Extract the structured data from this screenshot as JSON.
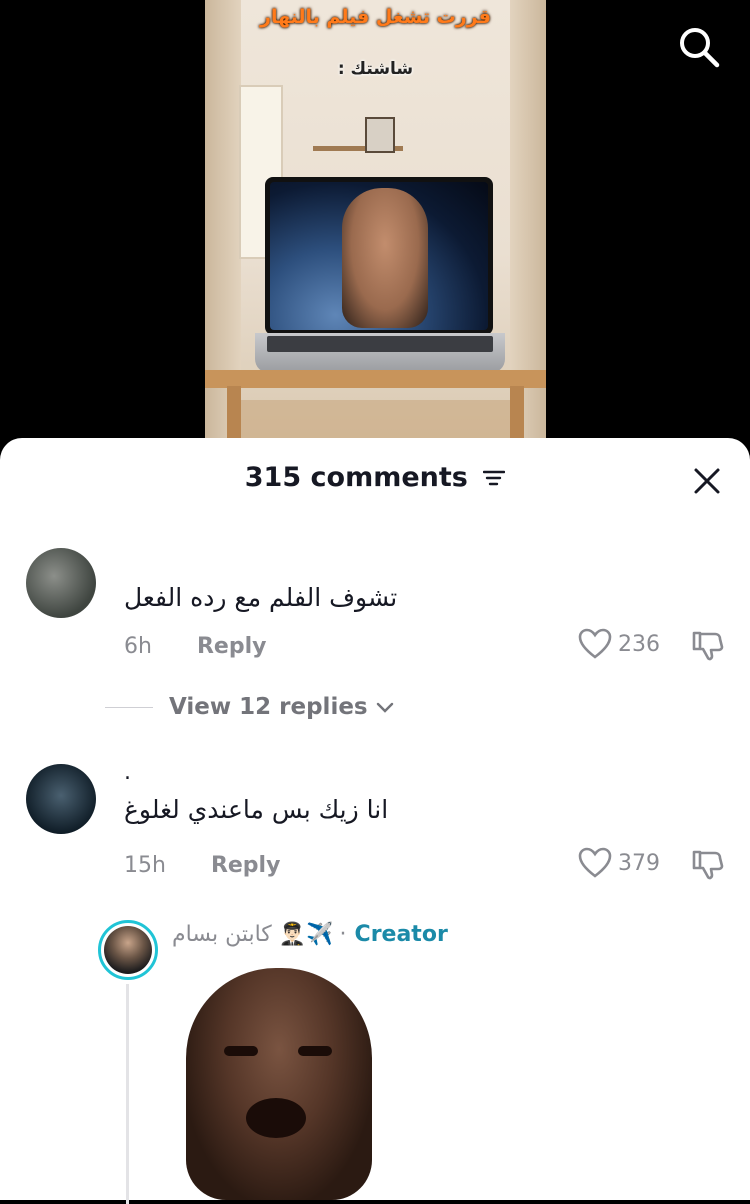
{
  "video": {
    "caption_top": "قررت تشغل فيلم بالنهار",
    "caption_second": "شاشتك :"
  },
  "sheet": {
    "title": "315 comments",
    "close_icon": "close-icon",
    "filter_icon": "filter-icon"
  },
  "comments": [
    {
      "text": "تشوف الفلم مع رده الفعل",
      "time": "6h",
      "reply_label": "Reply",
      "likes": "236",
      "view_replies": "View 12 replies"
    },
    {
      "username": ".",
      "text": "انا زيك بس ماعندي لغلوغ",
      "time": "15h",
      "reply_label": "Reply",
      "likes": "379"
    }
  ],
  "creator_reply": {
    "name": "كابتن بسام 👨🏻‍✈️✈️",
    "separator": "·",
    "badge": "Creator"
  },
  "colors": {
    "accent_cyan": "#20c4d6",
    "creator_label": "#1b8aa8",
    "caption_orange": "#ff7a1a"
  }
}
